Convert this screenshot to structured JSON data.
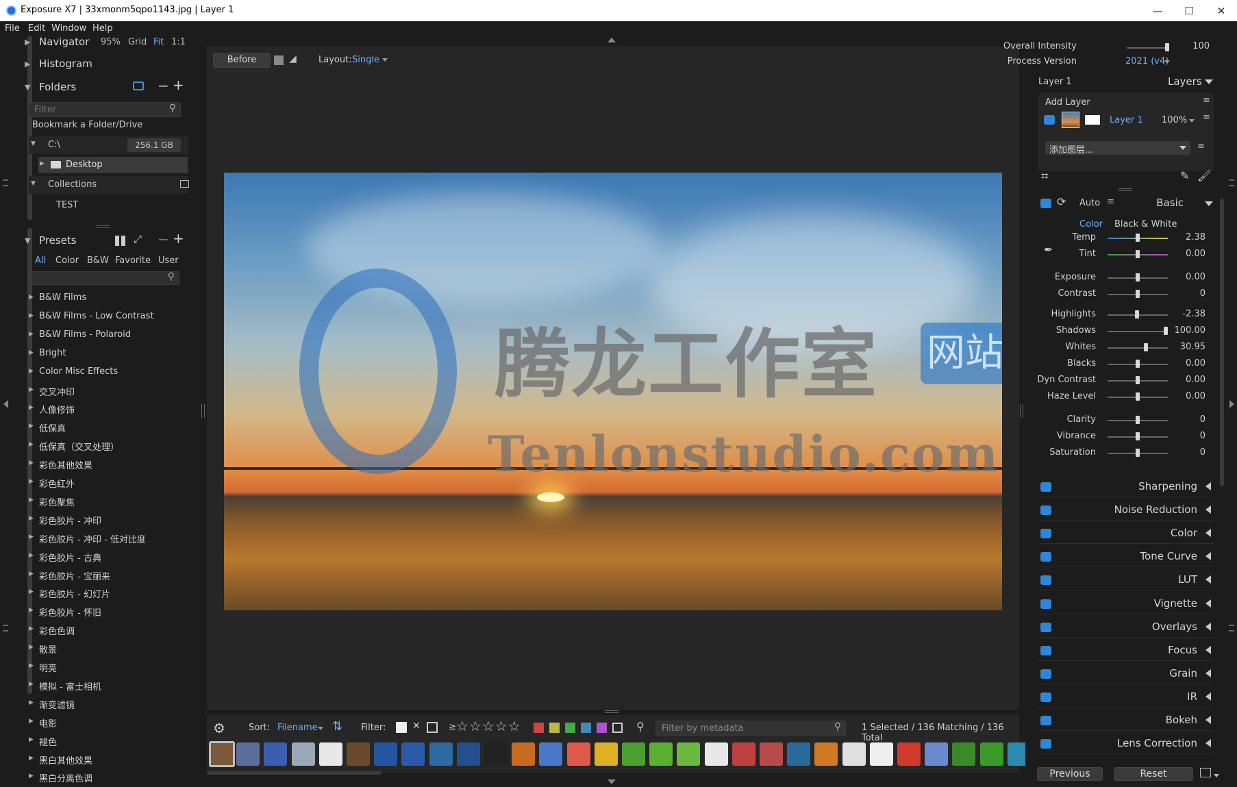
{
  "titlebar": {
    "title": "Exposure X7 | 33xmonm5qpo1143.jpg | Layer 1",
    "minimize": "—",
    "maximize": "☐",
    "close": "✕"
  },
  "menu": [
    "File",
    "Edit",
    "Window",
    "Help"
  ],
  "navigator": {
    "label": "Navigator",
    "zoom": "95%",
    "grid": "Grid",
    "fit": "Fit",
    "one_to_one": "1:1"
  },
  "histogram": {
    "label": "Histogram"
  },
  "folders": {
    "label": "Folders",
    "filter_placeholder": "Filter",
    "bookmark": "Bookmark a Folder/Drive",
    "drive": "C:\\",
    "drive_size": "256.1 GB",
    "desktop": "Desktop",
    "collections": "Collections",
    "test": "TEST"
  },
  "presets": {
    "label": "Presets",
    "tabs": [
      "All",
      "Color",
      "B&W",
      "Favorite",
      "User"
    ],
    "items": [
      "B&W Films",
      "B&W Films - Low Contrast",
      "B&W Films - Polaroid",
      "Bright",
      "Color Misc Effects",
      "交叉冲印",
      "人像修饰",
      "低保真",
      "低保真（交叉处理）",
      "彩色其他效果",
      "彩色红外",
      "彩色聚焦",
      "彩色胶片 - 冲印",
      "彩色胶片 - 冲印 - 低对比度",
      "彩色胶片 - 古典",
      "彩色胶片 - 宝丽来",
      "彩色胶片 - 幻灯片",
      "彩色胶片 - 怀旧",
      "彩色色调",
      "散景",
      "明亮",
      "模拟 - 富士相机",
      "渐变滤镜",
      "电影",
      "褪色",
      "黑白其他效果",
      "黑白分离色调"
    ]
  },
  "viewer": {
    "before": "Before",
    "layout_label": "Layout:",
    "layout_value": "Single",
    "watermark_cn": "腾龙工作室",
    "watermark_badge": "网站",
    "watermark_en": "Tenlonstudio.com"
  },
  "bottombar": {
    "sort_label": "Sort:",
    "sort_value": "Filename",
    "filter_label": "Filter:",
    "ge": "≥",
    "metadata_placeholder": "Filter by metadata",
    "status": "1 Selected / 136 Matching / 136 Total"
  },
  "right": {
    "overall_intensity": {
      "label": "Overall Intensity",
      "value": "100"
    },
    "process_version": {
      "label": "Process Version",
      "value": "2021 (v4)"
    },
    "layer_title": "Layer 1",
    "layers_label": "Layers",
    "add_layer": "Add Layer",
    "layer_name": "Layer 1",
    "layer_opacity": "100%",
    "add_layer_select": "添加图层...",
    "auto": "Auto",
    "basic": "Basic",
    "color_tab": "Color",
    "bw_tab": "Black & White",
    "sliders": [
      {
        "label": "Temp",
        "value": "2.38",
        "pos": 0.5
      },
      {
        "label": "Tint",
        "value": "0.00",
        "pos": 0.5
      },
      {
        "label": "Exposure",
        "value": "0.00",
        "pos": 0.5
      },
      {
        "label": "Contrast",
        "value": "0",
        "pos": 0.5
      },
      {
        "label": "Highlights",
        "value": "-2.38",
        "pos": 0.49
      },
      {
        "label": "Shadows",
        "value": "100.00",
        "pos": 0.97
      },
      {
        "label": "Whites",
        "value": "30.95",
        "pos": 0.64
      },
      {
        "label": "Blacks",
        "value": "0.00",
        "pos": 0.5
      },
      {
        "label": "Dyn Contrast",
        "value": "0.00",
        "pos": 0.5
      },
      {
        "label": "Haze Level",
        "value": "0.00",
        "pos": 0.5
      },
      {
        "label": "Clarity",
        "value": "0",
        "pos": 0.5
      },
      {
        "label": "Vibrance",
        "value": "0",
        "pos": 0.5
      },
      {
        "label": "Saturation",
        "value": "0",
        "pos": 0.5
      }
    ],
    "sections": [
      "Sharpening",
      "Noise Reduction",
      "Color",
      "Tone Curve",
      "LUT",
      "Vignette",
      "Overlays",
      "Focus",
      "Grain",
      "IR",
      "Bokeh",
      "Lens Correction"
    ],
    "previous": "Previous",
    "reset": "Reset"
  },
  "colors": {
    "accent": "#2f86d6",
    "link": "#6fb0ff",
    "panel": "#1c1c1c",
    "viewer": "#262626"
  }
}
